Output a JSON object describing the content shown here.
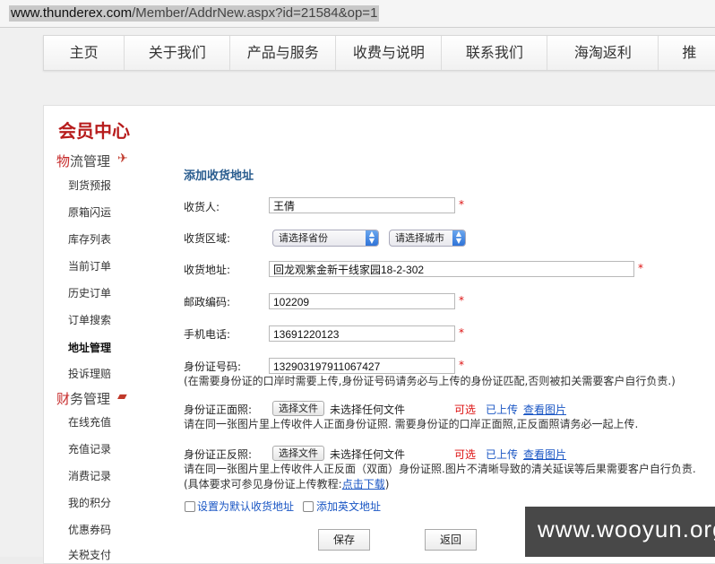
{
  "browser": {
    "url_host": "www.thunderex.com",
    "url_path": "/Member/AddrNew.aspx?id=21584&op=1"
  },
  "nav": {
    "items": [
      "主页",
      "关于我们",
      "产品与服务",
      "收费与说明",
      "联系我们",
      "海淘返利",
      "推"
    ]
  },
  "member_center": {
    "title": "会员中心"
  },
  "sidebar": {
    "logistics": {
      "label_em": "物",
      "label_rest": "流管理",
      "icon": "plane-icon"
    },
    "logistics_items": [
      "到货预报",
      "原箱闪运",
      "库存列表",
      "当前订单",
      "历史订单",
      "订单搜索",
      "地址管理",
      "投诉理赔"
    ],
    "finance": {
      "label_em": "财",
      "label_rest": "务管理",
      "icon": "card-icon"
    },
    "finance_items": [
      "在线充值",
      "充值记录",
      "消费记录",
      "我的积分",
      "优惠券码",
      "关税支付"
    ]
  },
  "form": {
    "title": "添加收货地址",
    "receiver": {
      "label": "收货人:",
      "value": "王倩"
    },
    "region": {
      "label": "收货区域:",
      "province": "请选择省份",
      "city": "请选择城市"
    },
    "address": {
      "label": "收货地址:",
      "value": "回龙观紫金新干线家园18-2-302"
    },
    "postcode": {
      "label": "邮政编码:",
      "value": "102209"
    },
    "mobile": {
      "label": "手机电话:",
      "value": "13691220123"
    },
    "idnumber": {
      "label": "身份证号码:",
      "value": "132903197911067427",
      "note": "(在需要身份证的口岸时需要上传,身份证号码请务必与上传的身份证匹配,否则被扣关需要客户自行负责.)"
    },
    "id_front": {
      "label": "身份证正面照:",
      "choose": "选择文件",
      "status": "未选择任何文件",
      "optional": "可选",
      "uploaded": "已上传",
      "view": "查看图片",
      "note": "请在同一张图片里上传收件人正面身份证照. 需要身份证的口岸正面照,正反面照请务必一起上传."
    },
    "id_back": {
      "label": "身份证正反照:",
      "choose": "选择文件",
      "status": "未选择任何文件",
      "optional": "可选",
      "uploaded": "已上传",
      "view": "查看图片",
      "note1": "请在同一张图片里上传收件人正反面（双面）身份证照.图片不清晰导致的清关延误等后果需要客户自行负责.",
      "note2_prefix": "(具体要求可参见身份证上传教程:",
      "note2_link": "点击下载",
      "note2_suffix": ")"
    },
    "required_mark": "*",
    "default_addr": "设置为默认收货地址",
    "english_addr": "添加英文地址",
    "save": "保存",
    "back": "返回"
  },
  "watermark": "www.wooyun.org"
}
